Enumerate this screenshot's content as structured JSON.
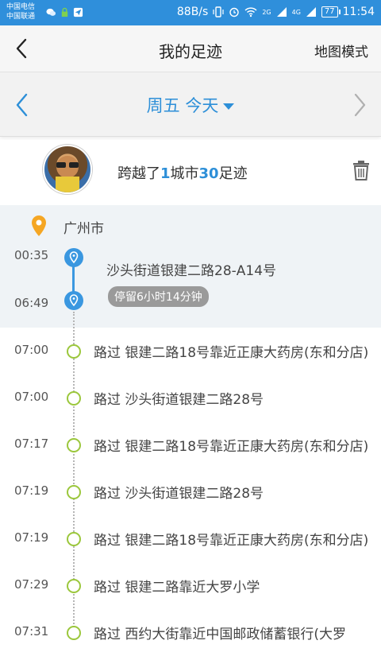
{
  "status_bar": {
    "carrier1": "中国电信",
    "carrier2": "中国联通",
    "speed": "88B/s",
    "net1": "2G",
    "net2": "4G",
    "battery": "77",
    "time": "11:54"
  },
  "header": {
    "title": "我的足迹",
    "map_mode": "地图模式"
  },
  "date_bar": {
    "label": "周五 今天"
  },
  "summary": {
    "prefix": "跨越了",
    "city_count": "1",
    "middle": "城市",
    "footprint_count": "30",
    "suffix": "足迹"
  },
  "city": "广州市",
  "stay": {
    "start_time": "00:35",
    "end_time": "06:49",
    "address": "沙头街道银建二路28-A14号",
    "duration": "停留6小时14分钟"
  },
  "passes": [
    {
      "time": "07:00",
      "text": "路过 银建二路18号靠近正康大药房(东和分店)"
    },
    {
      "time": "07:00",
      "text": "路过 沙头街道银建二路28号"
    },
    {
      "time": "07:17",
      "text": "路过 银建二路18号靠近正康大药房(东和分店)"
    },
    {
      "time": "07:19",
      "text": "路过 沙头街道银建二路28号"
    },
    {
      "time": "07:19",
      "text": "路过 银建二路18号靠近正康大药房(东和分店)"
    },
    {
      "time": "07:29",
      "text": "路过 银建二路靠近大罗小学"
    },
    {
      "time": "07:31",
      "text": "路过 西约大街靠近中国邮政储蓄银行(大罗"
    }
  ],
  "colors": {
    "accent": "#2d8fd8",
    "status_bar": "#2f8fdb",
    "pass_dot": "#9bc73c",
    "pin": "#f5a623"
  }
}
